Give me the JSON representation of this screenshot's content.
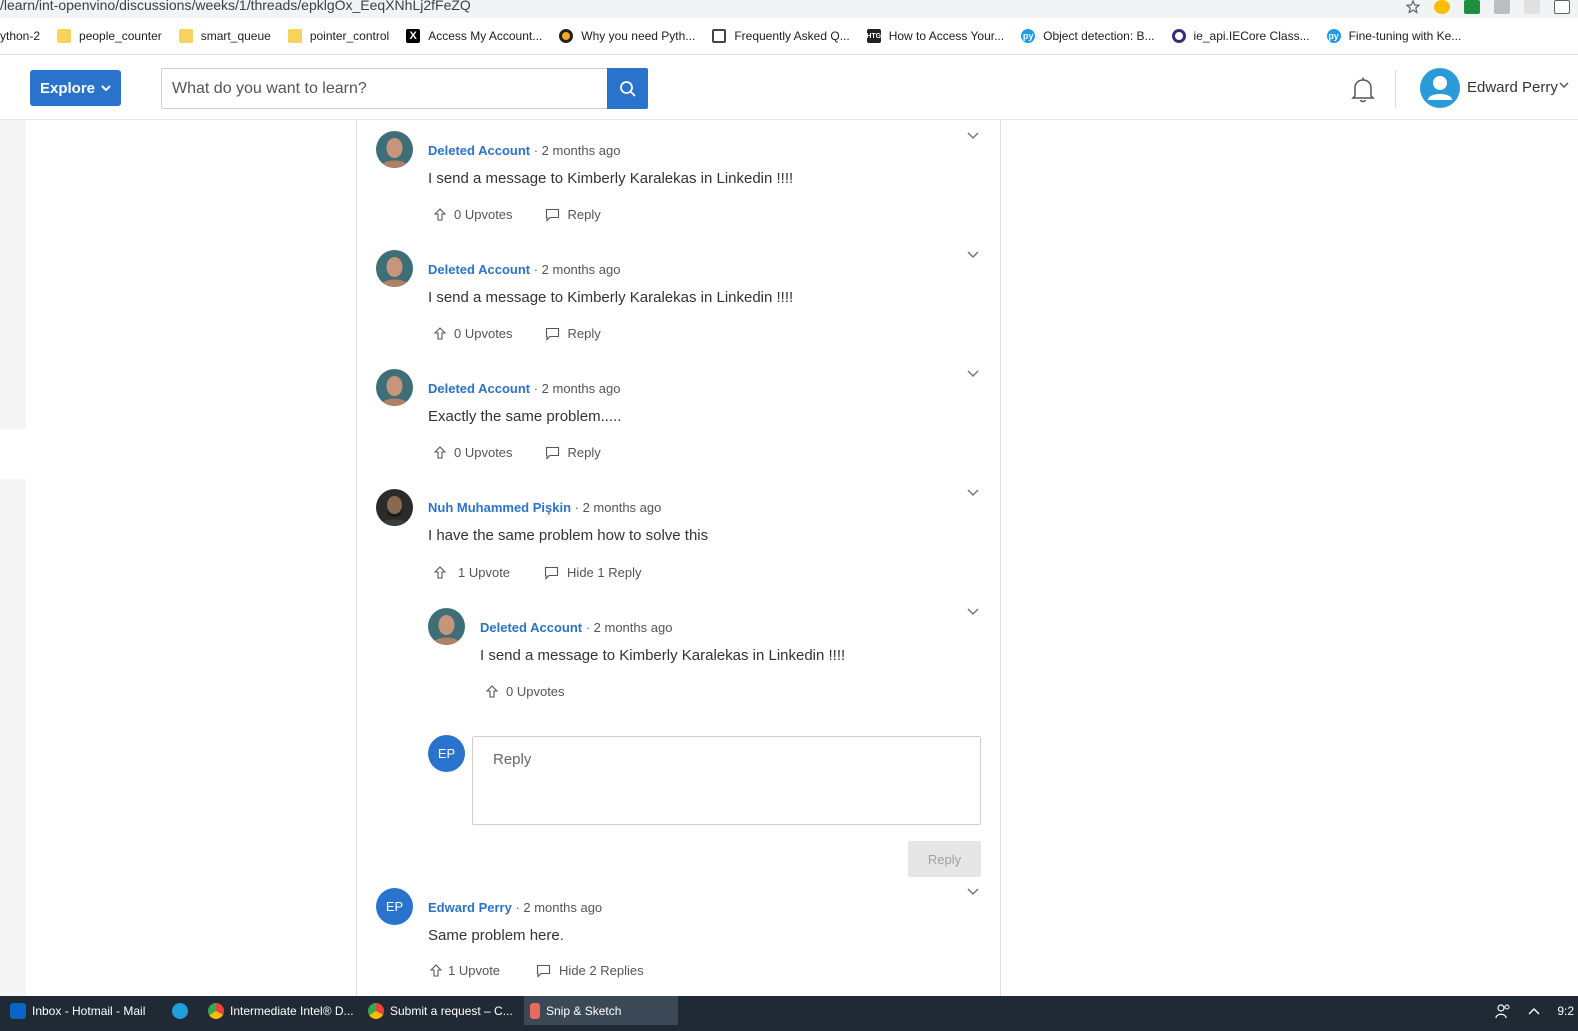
{
  "browser": {
    "url": "/learn/int-openvino/discussions/weeks/1/threads/epklgOx_EeqXNhLj2fFeZQ",
    "bookmarks": [
      {
        "label": "ython-2",
        "icon": "none"
      },
      {
        "label": "people_counter",
        "icon": "folder-icon"
      },
      {
        "label": "smart_queue",
        "icon": "folder-icon"
      },
      {
        "label": "pointer_control",
        "icon": "folder-icon"
      },
      {
        "label": "Access My Account...",
        "icon": "x-icon"
      },
      {
        "label": "Why you need Pyth...",
        "icon": "medium-icon"
      },
      {
        "label": "Frequently Asked Q...",
        "icon": "doc-icon"
      },
      {
        "label": "How to Access Your...",
        "icon": "htg-icon"
      },
      {
        "label": "Object detection: B...",
        "icon": "pytorch-icon"
      },
      {
        "label": "ie_api.IECore Class...",
        "icon": "circle-icon"
      },
      {
        "label": "Fine-tuning with Ke...",
        "icon": "pytorch-icon"
      }
    ]
  },
  "header": {
    "explore_label": "Explore",
    "search_placeholder": "What do you want to learn?",
    "user_name": "Edward Perry"
  },
  "comments": [
    {
      "author": "Deleted Account",
      "time": " · 2 months ago",
      "body": "I send a message to Kimberly Karalekas in Linkedin !!!!",
      "upvotes": "0 Upvotes",
      "reply": "Reply"
    },
    {
      "author": "Deleted Account",
      "time": " · 2 months ago",
      "body": "I send a message to Kimberly Karalekas in Linkedin !!!!",
      "upvotes": "0 Upvotes",
      "reply": "Reply"
    },
    {
      "author": "Deleted Account",
      "time": " · 2 months ago",
      "body": "Exactly the same problem.....",
      "upvotes": "0 Upvotes",
      "reply": "Reply"
    },
    {
      "author": "Nuh Muhammed Pişkin",
      "time": " · 2 months ago",
      "body": "I have the same problem how to solve this",
      "upvotes": "1 Upvote",
      "reply": "Hide 1 Reply"
    },
    {
      "author": "Deleted Account",
      "time": " · 2 months ago",
      "body": "I send a message to Kimberly Karalekas in Linkedin !!!!",
      "upvotes": "0 Upvotes"
    },
    {
      "author": "Edward Perry",
      "time": " · 2 months ago",
      "body": "Same problem here.",
      "upvotes": "1 Upvote",
      "reply": "Hide 2 Replies"
    }
  ],
  "reply_form": {
    "initials": "EP",
    "placeholder": "Reply",
    "submit_label": "Reply"
  },
  "taskbar": {
    "items": [
      {
        "label": "Inbox - Hotmail - Mail"
      },
      {
        "label": ""
      },
      {
        "label": "Intermediate Intel® D..."
      },
      {
        "label": "Submit a request – C..."
      },
      {
        "label": "Snip & Sketch"
      }
    ],
    "clock": "9:2"
  },
  "colors": {
    "brand_blue": "#2a73cc",
    "taskbar_bg": "#1f2a35"
  }
}
